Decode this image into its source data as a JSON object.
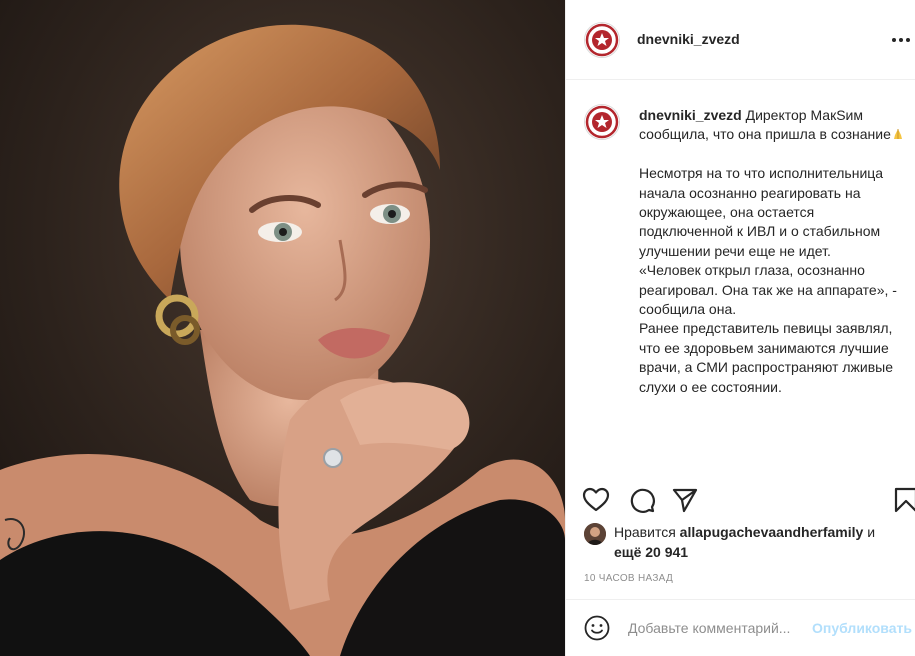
{
  "post": {
    "username": "dnevniki_zvezd",
    "caption": "Директор МакSим сообщила, что она пришла в сознание",
    "caption_body": "Несмотря на то что исполнительница начала осознанно реагировать на окружающее, она остается подключенной к ИВЛ и о стабильном улучшении речи еще не идет.\n«Человек открыл глаза, осознанно реагировал. Она так же на аппарате», - сообщила она.\nРанее представитель певицы заявлял, что ее здоровьем занимаются лучшие врачи, а СМИ распространяют лживые слухи о ее состоянии.",
    "caption_emoji": "praying-hands-icon"
  },
  "likes": {
    "prefix": "Нравится",
    "user": "allapugachevaandherfamily",
    "conjunction": "и",
    "others": "ещё 20 941"
  },
  "timestamp": "10 часов назад",
  "comment": {
    "placeholder": "Добавьте комментарий...",
    "publish_label": "Опубликовать"
  },
  "icons": [
    "more-icon",
    "heart-icon",
    "comment-icon",
    "share-icon",
    "bookmark-icon",
    "smiley-icon"
  ],
  "colors": {
    "text": "#262626",
    "muted": "#8e8e8e",
    "link_disabled": "#b2dffc",
    "border": "#efefef",
    "logo_red": "#b3262d"
  }
}
